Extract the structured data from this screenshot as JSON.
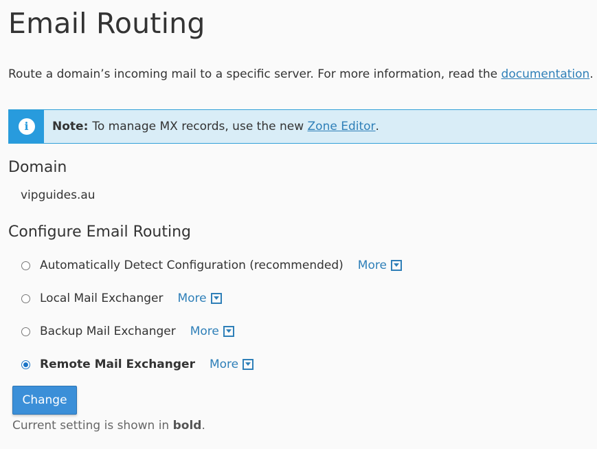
{
  "page": {
    "title": "Email Routing",
    "intro_text": "Route a domain’s incoming mail to a specific server. For more information, read the",
    "intro_link": "documentation",
    "intro_end": "."
  },
  "note": {
    "icon": "info-icon",
    "label": "Note:",
    "text": "To manage MX records, use the new",
    "link": "Zone Editor",
    "end": "."
  },
  "domain": {
    "heading": "Domain",
    "value": "vipguides.au"
  },
  "routing": {
    "heading": "Configure Email Routing",
    "options": [
      {
        "label": "Automatically Detect Configuration (recommended)",
        "more": "More",
        "checked": false
      },
      {
        "label": "Local Mail Exchanger",
        "more": "More",
        "checked": false
      },
      {
        "label": "Backup Mail Exchanger",
        "more": "More",
        "checked": false
      },
      {
        "label": "Remote Mail Exchanger",
        "more": "More",
        "checked": true
      }
    ],
    "change_button": "Change",
    "footer_text": "Current setting is shown in",
    "footer_bold": "bold",
    "footer_end": "."
  },
  "colors": {
    "link": "#2e7fb8",
    "button": "#3b8fd8",
    "info_accent": "#289bdd",
    "info_background": "#d9edf7"
  }
}
